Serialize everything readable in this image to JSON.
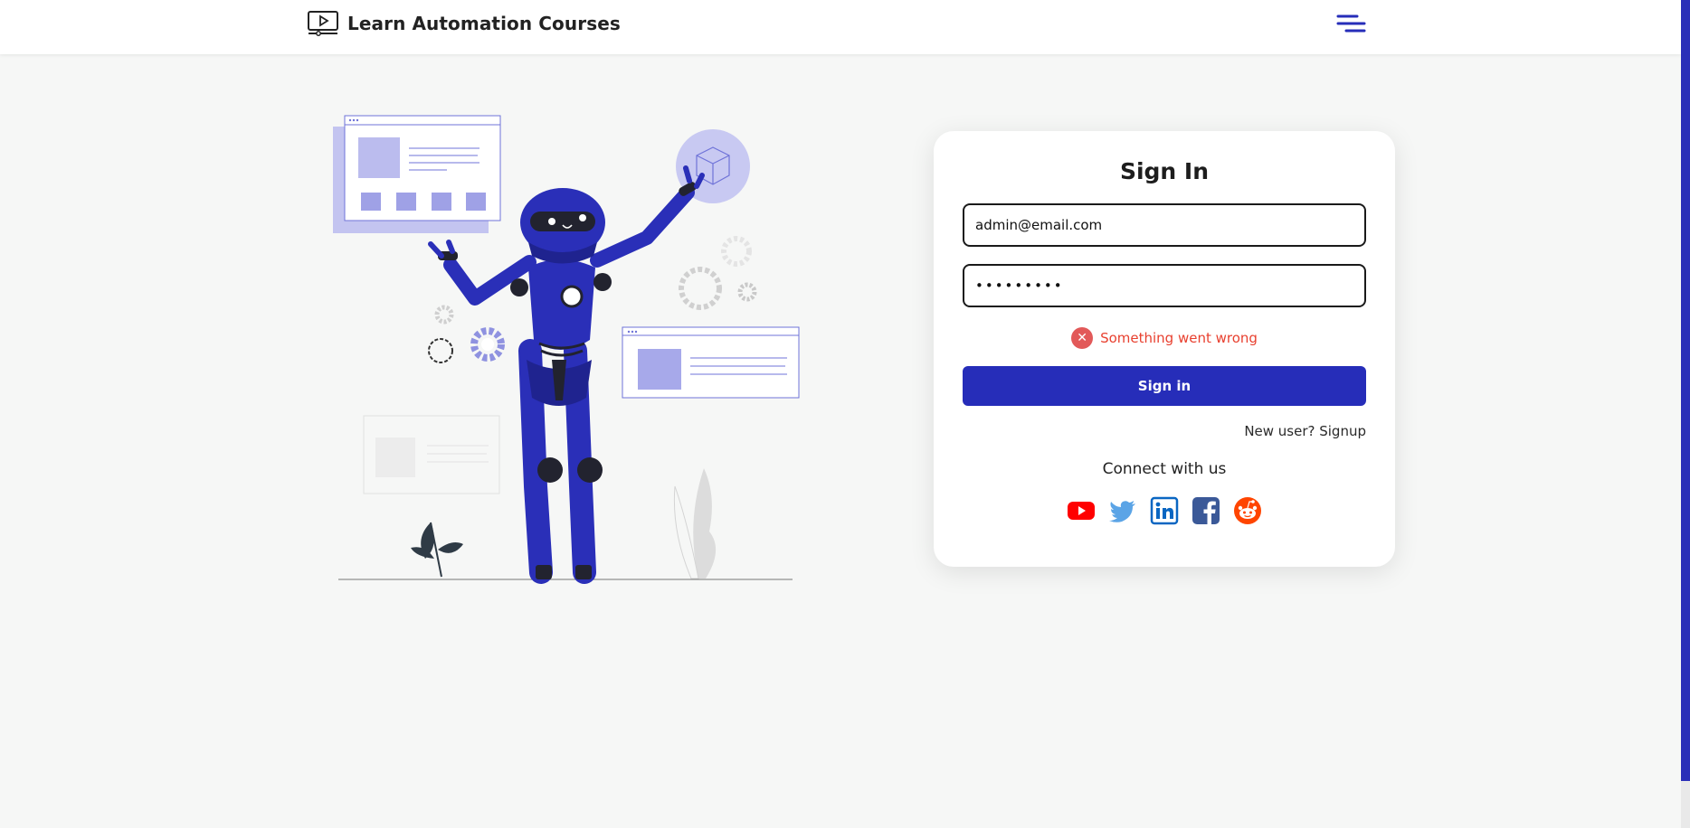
{
  "header": {
    "title": "Learn Automation Courses",
    "logo_icon": "video-player-icon",
    "menu_icon": "hamburger-menu-icon",
    "accent_color": "#262db9"
  },
  "login": {
    "title": "Sign In",
    "email_value": "admin@email.com",
    "password_value": "•••••••••",
    "error_message": "Something went wrong",
    "error_icon": "close-circle-icon",
    "signin_label": "Sign in",
    "signup_label": "New user? Signup",
    "connect_label": "Connect with us",
    "socials": [
      "youtube-icon",
      "twitter-icon",
      "linkedin-icon",
      "facebook-icon",
      "reddit-icon"
    ]
  },
  "colors": {
    "background": "#f6f7f6",
    "error": "#e8402f",
    "button": "#262db9"
  }
}
